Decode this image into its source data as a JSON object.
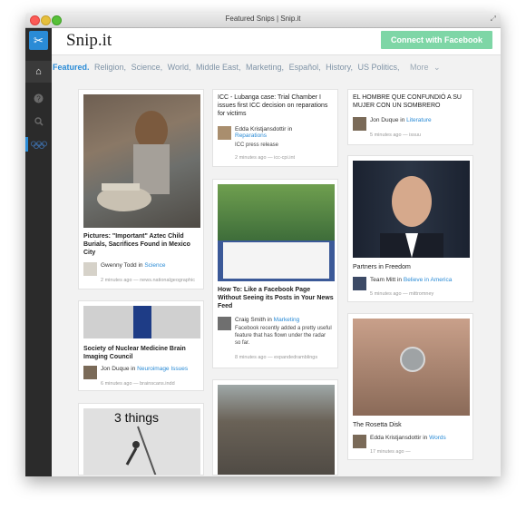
{
  "window": {
    "title": "Featured Snips | Snip.it"
  },
  "sidebar": {
    "logo_icon": "scissors-icon",
    "items": [
      "home-icon",
      "help-icon",
      "search-icon",
      "olympic-rings-icon"
    ]
  },
  "header": {
    "brand": "Snip.it",
    "connect_label": "Connect with Facebook"
  },
  "nav": {
    "items": [
      "Featured.",
      "Religion,",
      "Science,",
      "World,",
      "Middle East,",
      "Marketing,",
      "Español,",
      "History,",
      "US Politics,"
    ],
    "more": "More",
    "more_icon": "chevron-down-icon"
  },
  "cards": {
    "aztec": {
      "title": "Pictures: \"Important\" Aztec Child Burials, Sacrifices Found in Mexico City",
      "author": "Gwenny Todd",
      "in": "in",
      "category": "Science",
      "meta": "2 minutes ago — news.nationalgeographic"
    },
    "nuclear": {
      "title": "Society of Nuclear Medicine Brain Imaging Council",
      "author": "Jon Duque",
      "in": "in",
      "category": "Neuroimage Issues",
      "meta": "6 minutes ago — brainscans.indd"
    },
    "things": {
      "overlay": "3 things"
    },
    "icc": {
      "title": "ICC - Lubanga case: Trial Chamber I issues first ICC decision on reparations for victims",
      "author": "Edda Kristjansdottir",
      "in": "in",
      "category": "Reparations",
      "desc": "ICC press release",
      "meta": "2 minutes ago — icc-cpi.int"
    },
    "facebook": {
      "title": "How To: Like a Facebook Page Without Seeing its Posts in Your News Feed",
      "author": "Craig Smith",
      "in": "in",
      "category": "Marketing",
      "desc": "Facebook recently added a pretty useful feature that has flown under the radar so far.",
      "meta": "8 minutes ago — expandedramblings"
    },
    "hombre": {
      "title": "EL HOMBRE QUE CONFUNDIÓ A SU MUJER CON UN SOMBRERO",
      "author": "Jon Duque",
      "in": "in",
      "category": "Literature",
      "meta": "5 minutes ago — issuu"
    },
    "partners": {
      "title": "Partners in Freedom",
      "author": "Team Mitt",
      "in": "in",
      "category": "Believe in America",
      "meta": "5 minutes ago — mittromney"
    },
    "rosetta": {
      "title": "The Rosetta Disk",
      "author": "Edda Kristjansdottir",
      "in": "in",
      "category": "Words",
      "meta": "17 minutes ago —"
    }
  }
}
